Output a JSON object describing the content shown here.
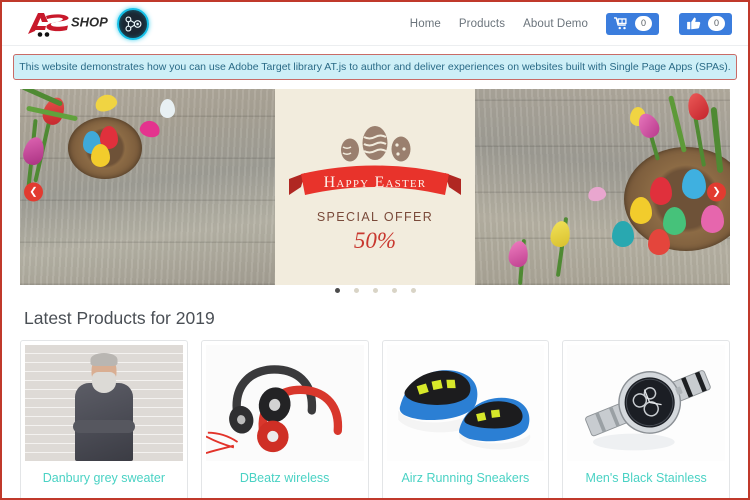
{
  "header": {
    "brand_name": "SHOP",
    "brand_mark_letters": "A S",
    "at_badge_name": "adobe-target-node-icon",
    "nav_links": [
      {
        "label": "Home"
      },
      {
        "label": "Products"
      },
      {
        "label": "About Demo"
      }
    ],
    "cart_button": {
      "icon": "shopping-cart-icon",
      "count": "0"
    },
    "likes_button": {
      "icon": "thumbs-up-icon",
      "count": "0"
    },
    "accent_blue": "#3b7ddd"
  },
  "info_banner": {
    "text": "This website demonstrates how you can use Adobe Target library AT.js to author and deliver experiences on websites built with Single Page Apps (SPAs).",
    "background": "#cdeff7",
    "border_color": "#c96b66",
    "text_color": "#2a6a86"
  },
  "carousel": {
    "prev_label": "❮",
    "next_label": "❯",
    "slide": {
      "headline": "Happy Easter",
      "subhead": "SPECIAL OFFER",
      "discount": "50%",
      "background_description": "easter-eggs-on-rustic-wood"
    },
    "dots": [
      {
        "active": true
      },
      {
        "active": false
      },
      {
        "active": false
      },
      {
        "active": false
      },
      {
        "active": false
      }
    ],
    "active_index": 0,
    "total_slides": 5
  },
  "products_section": {
    "title": "Latest Products for 2019",
    "link_color": "#4ad2c4",
    "items": [
      {
        "name": "Danbury grey sweater",
        "image": "man-in-grey-sweater-white-brick-wall"
      },
      {
        "name": "DBeatz wireless",
        "image": "black-red-over-ear-headphones"
      },
      {
        "name": "Airz Running Sneakers",
        "image": "blue-black-yellow-running-shoes"
      },
      {
        "name": "Men's Black Stainless",
        "image": "silver-stainless-steel-chronograph-watch"
      }
    ]
  },
  "page": {
    "border_color": "#c0392b"
  }
}
